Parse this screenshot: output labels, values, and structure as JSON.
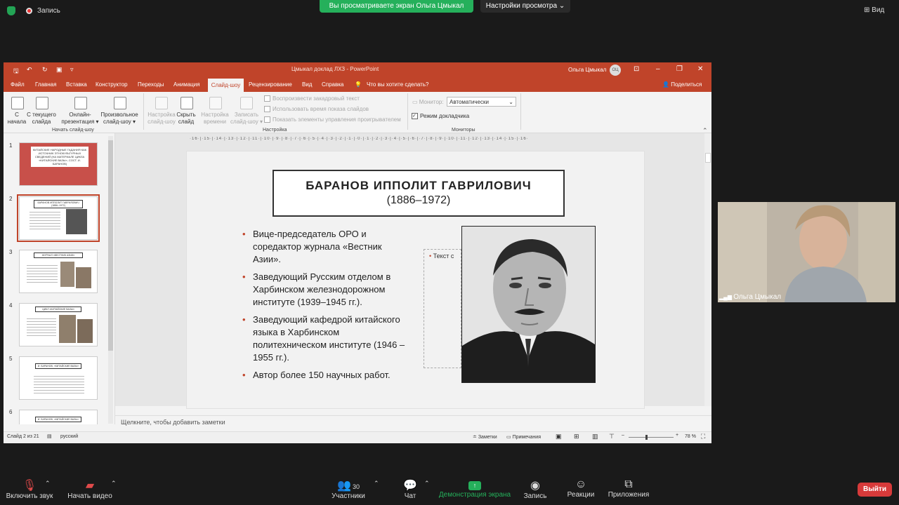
{
  "zoom": {
    "recording_label": "Запись",
    "viewing_banner": "Вы просматриваете экран Ольга Цмыкал",
    "view_settings": "Настройки просмотра ⌄",
    "view_button": "Вид"
  },
  "ppt": {
    "window_title": "Цмыкал доклад ЛХЗ  -  PowerPoint",
    "user_name": "Ольга Цмыкал",
    "user_initials": "ОЦ",
    "tabs": [
      "Файл",
      "Главная",
      "Вставка",
      "Конструктор",
      "Переходы",
      "Анимация",
      "Слайд-шоу",
      "Рецензирование",
      "Вид",
      "Справка"
    ],
    "active_tab": "Слайд-шоу",
    "search": "Что вы хотите сделать?",
    "share": "Поделиться",
    "ribbon": {
      "from_start": "С начала",
      "from_current_1": "С текущего",
      "from_current_2": "слайда",
      "online_1": "Онлайн-",
      "online_2": "презентация ▾",
      "custom_1": "Произвольное",
      "custom_2": "слайд-шоу ▾",
      "group_start": "Начать слайд-шоу",
      "setup_1": "Настройка",
      "setup_2": "слайд-шоу",
      "hide_1": "Скрыть",
      "hide_2": "слайд",
      "rehearse_1": "Настройка",
      "rehearse_2": "времени",
      "record_1": "Записать",
      "record_2": "слайд-шоу ▾",
      "chk_narration": "Воспроизвести закадровый текст",
      "chk_timings": "Использовать время показа слайдов",
      "chk_controls": "Показать элементы управления проигрывателем",
      "group_setup": "Настройка",
      "monitor_label": "Монитор:",
      "monitor_value": "Автоматически",
      "presenter_view": "Режим докладчика",
      "group_monitors": "Мониторы"
    },
    "thumbnails": [
      {
        "num": "1",
        "title": "КИТАЙСКИЕ НАРОДНЫЕ ГАДАНИЯ КАК ИСТОЧНИК ЭТНОКУЛЬТУРНЫХ СВЕДЕНИЙ (НА МАТЕРИАЛЕ ЦИКЛА «КИТАЙСКИЕ ВАЗЫ», СОСТ. И. БАРАНОВ)"
      },
      {
        "num": "2",
        "title": "БАРАНОВ ИППОЛИТ ГАВРИЛОВИЧ (1886–1972)"
      },
      {
        "num": "3",
        "title": "ЖУРНАЛ «ВЕСТНИК АЗИИ»"
      },
      {
        "num": "4",
        "title": "ЦИКЛ «КИТАЙСКИЕ ВАЗЫ»"
      },
      {
        "num": "5",
        "title": "И. БАРАНОВ, «КИТАЙСКИЕ ВАЗЫ»"
      },
      {
        "num": "6",
        "title": "И. БАРАНОВ, «КИТАЙСКИЕ ВАЗЫ»"
      }
    ],
    "slide": {
      "title": "БАРАНОВ ИППОЛИТ ГАВРИЛОВИЧ",
      "subtitle": "(1886–1972)",
      "bullets": [
        "Вице-председатель ОРО и соредактор журнала «Вестник Азии».",
        "Заведующий Русским отделом в Харбинском железнодорожном институте (1939–1945 гг.).",
        "Заведующий кафедрой китайского языка в Харбинском политехническом институте (1946 –1955 гг.).",
        "Автор более 150 научных работ."
      ],
      "placeholder": "Текст с"
    },
    "notes_placeholder": "Щелкните, чтобы добавить заметки",
    "status": {
      "slide": "Слайд 2 из 21",
      "language": "русский",
      "notes": "Заметки",
      "comments": "Примечания",
      "zoom": "78 %"
    }
  },
  "video": {
    "name": "Ольга Цмыкал"
  },
  "toolbar": {
    "unmute": "Включить звук",
    "start_video": "Начать видео",
    "participants": "Участники",
    "participants_count": "30",
    "chat": "Чат",
    "share_screen": "Демонстрация экрана",
    "record": "Запись",
    "reactions": "Реакции",
    "apps": "Приложения",
    "leave": "Выйти"
  },
  "colors": {
    "ppt_accent": "#c0442a",
    "zoom_green": "#25b05b",
    "leave_red": "#d73a3a"
  }
}
